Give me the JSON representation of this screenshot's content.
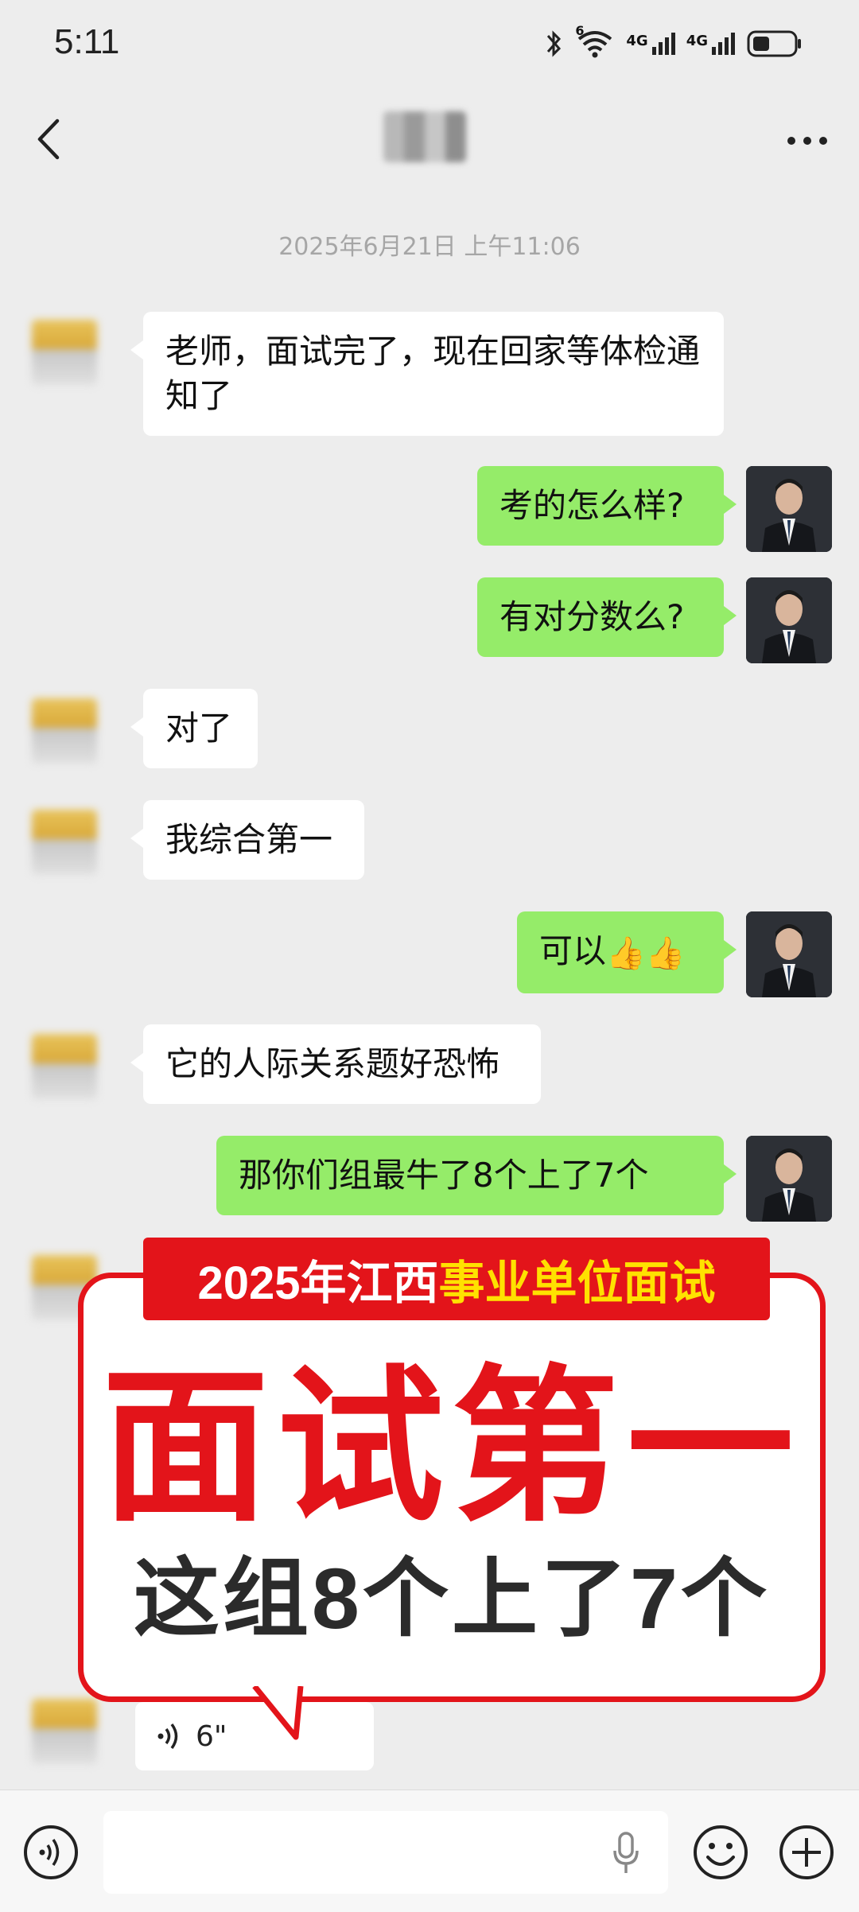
{
  "status_bar": {
    "time": "5:11",
    "wifi_label": "6",
    "signal_1_label": "4G",
    "signal_2_label": "4G"
  },
  "nav": {
    "title_blurred": true,
    "more_label": "···"
  },
  "chat": {
    "timestamp": "2025年6月21日 上午11:06",
    "messages": [
      {
        "side": "in",
        "text": "老师，面试完了，现在回家等体检通知了"
      },
      {
        "side": "out",
        "text": "考的怎么样?"
      },
      {
        "side": "out",
        "text": "有对分数么?"
      },
      {
        "side": "in",
        "text": "对了"
      },
      {
        "side": "in",
        "text": "我综合第一"
      },
      {
        "side": "out",
        "text": "可以",
        "emoji": "👍👍"
      },
      {
        "side": "in",
        "text": "它的人际关系题好恐怖"
      },
      {
        "side": "out",
        "text": "那你们组最牛了8个上了7个"
      }
    ],
    "voice_message": {
      "duration": "6\""
    }
  },
  "promo": {
    "banner_prefix": "2025年江西",
    "banner_highlight": "事业单位面试",
    "main_text": "面试第一",
    "sub_text": "这组8个上了7个"
  },
  "colors": {
    "out_bubble": "#95ec69",
    "in_bubble": "#ffffff",
    "background": "#ededed",
    "promo_red": "#e3141a",
    "promo_yellow": "#ffe100"
  },
  "input_bar": {
    "icons": [
      "voice-icon",
      "microphone-icon",
      "emoji-icon",
      "plus-icon"
    ]
  }
}
